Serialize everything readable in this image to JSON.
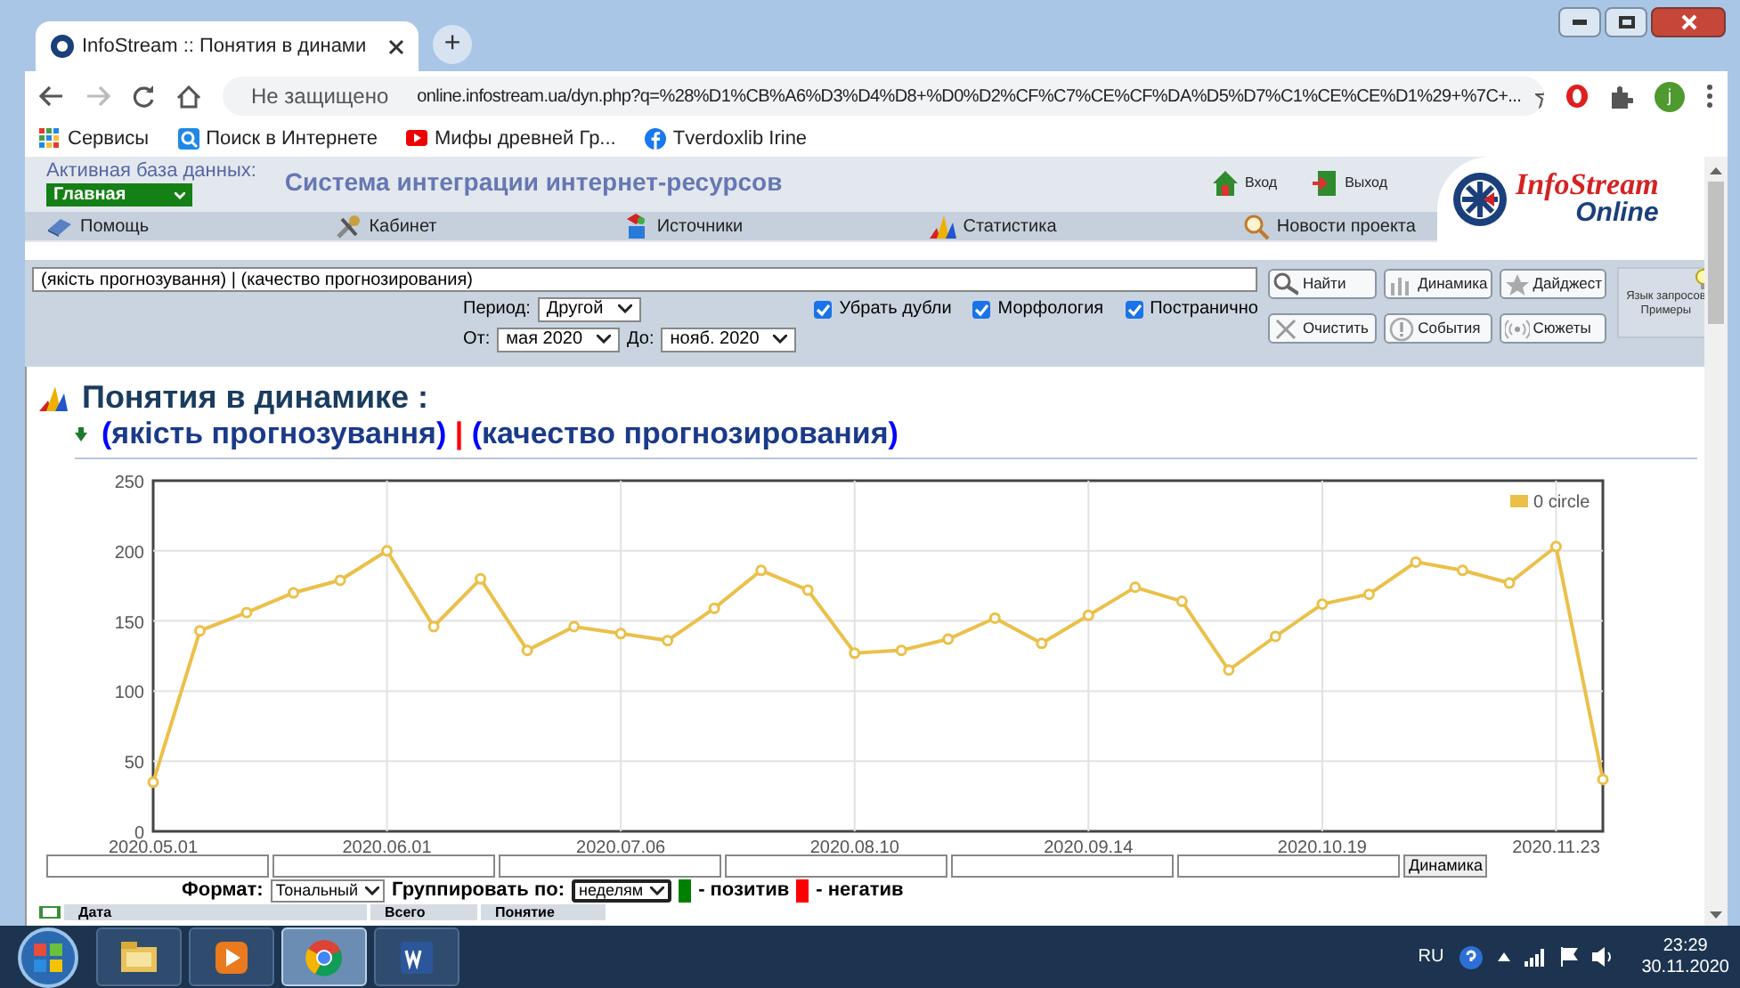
{
  "browser": {
    "tab_title": "InfoStream :: Понятия в динами",
    "new_tab": "+",
    "security": "Не защищено",
    "url": "online.infostream.ua/dyn.php?q=%28%D1%CB%A6%D3%D4%D8+%D0%D2%CF%C7%CE%CF%DA%D5%D7%C1%CE%CE%D1%29+%7C+...",
    "profile": "j",
    "bookmarks": [
      {
        "label": "Сервисы",
        "kind": "apps"
      },
      {
        "label": "Поиск в Интернете",
        "kind": "search"
      },
      {
        "label": "Мифы древней Гр...",
        "kind": "video"
      },
      {
        "label": "Tverdoxlib Irine",
        "kind": "social"
      }
    ]
  },
  "header": {
    "db_label": "Активная база данных:",
    "db_value": "Главная",
    "title": "Система интеграции интернет-ресурсов",
    "login": "Вход",
    "logout": "Выход",
    "logo_main": "InfoStream",
    "logo_sub": "Online"
  },
  "menu": [
    {
      "label": "Помощь",
      "kind": "help"
    },
    {
      "label": "Кабинет",
      "kind": "tools"
    },
    {
      "label": "Источники",
      "kind": "sources"
    },
    {
      "label": "Статистика",
      "kind": "stats"
    },
    {
      "label": "Новости проекта",
      "kind": "news"
    }
  ],
  "search": {
    "query": "(якість прогнозування) | (качество прогнозирования)",
    "period_label": "Период:",
    "period": "Другой",
    "from_label": "От:",
    "from": "мая 2020",
    "to_label": "До:",
    "to": "нояб. 2020",
    "options": [
      {
        "label": "Убрать дубли",
        "checked": true
      },
      {
        "label": "Морфология",
        "checked": true
      },
      {
        "label": "Постранично",
        "checked": true
      }
    ],
    "buttons": [
      {
        "label": "Найти",
        "kind": "search"
      },
      {
        "label": "Динамика",
        "kind": "chart"
      },
      {
        "label": "Дайджест",
        "kind": "star"
      },
      {
        "label": "Очистить",
        "kind": "clear"
      },
      {
        "label": "События",
        "kind": "alert"
      },
      {
        "label": "Сюжеты",
        "kind": "radio"
      }
    ],
    "hint": [
      "Язык запросов",
      "Примеры"
    ]
  },
  "content": {
    "title": "Понятия в динамике :",
    "query_parts": [
      {
        "text": "(",
        "color": "#0000ff"
      },
      {
        "text": "якість прогнозування",
        "color": "#1a3a8a"
      },
      {
        "text": ")",
        "color": "#0000ff"
      },
      {
        "text": " | ",
        "color": "#ff0000"
      },
      {
        "text": "(",
        "color": "#0000ff"
      },
      {
        "text": "качество прогнозирования",
        "color": "#1a3a8a"
      },
      {
        "text": ")",
        "color": "#0000ff"
      }
    ],
    "chart_data": {
      "type": "line",
      "categories": [
        "2020.05.01",
        null,
        null,
        null,
        null,
        "2020.06.01",
        null,
        null,
        null,
        null,
        "2020.07.06",
        null,
        null,
        null,
        null,
        "2020.08.10",
        null,
        null,
        null,
        null,
        "2020.09.14",
        null,
        null,
        null,
        null,
        "2020.10.19",
        null,
        null,
        null,
        null,
        "2020.11.23",
        null
      ],
      "grid": true,
      "series": [
        {
          "name": "0 circle",
          "color": "#ebc04a",
          "marker": "circle",
          "values": [
            35,
            143,
            156,
            170,
            179,
            200,
            146,
            180,
            129,
            146,
            141,
            136,
            159,
            186,
            172,
            127,
            129,
            137,
            152,
            134,
            154,
            174,
            164,
            115,
            139,
            162,
            169,
            192,
            186,
            177,
            203,
            37
          ]
        }
      ],
      "ylim": [
        0,
        250
      ],
      "yticks": [
        0,
        50,
        100,
        150,
        200,
        250
      ]
    },
    "range_button": "Динамика",
    "format": {
      "label": "Формат:",
      "value": "Тональный",
      "group_label": "Группировать по:",
      "group_value": "неделям",
      "legend": [
        {
          "label": "- позитив",
          "color": "#008000"
        },
        {
          "label": "- негатив",
          "color": "#ff0000"
        }
      ]
    },
    "table": {
      "columns": [
        "Дата",
        "Всего",
        "Понятие"
      ]
    }
  },
  "taskbar": {
    "apps": [
      {
        "kind": "explorer",
        "selected": false
      },
      {
        "kind": "player",
        "selected": false
      },
      {
        "kind": "chrome",
        "selected": true
      },
      {
        "kind": "word",
        "selected": false
      }
    ],
    "lang": "RU",
    "time": "23:29",
    "date": "30.11.2020"
  }
}
